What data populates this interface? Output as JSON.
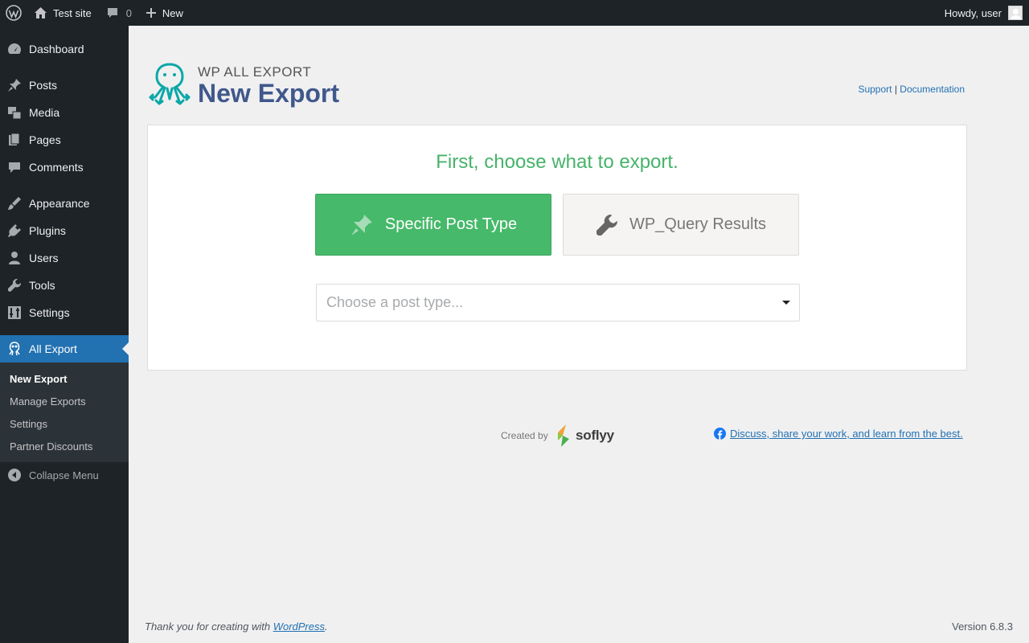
{
  "admin_bar": {
    "site_name": "Test site",
    "comments_count": "0",
    "new_label": "New",
    "howdy": "Howdy, user"
  },
  "sidebar": {
    "items": [
      {
        "label": "Dashboard",
        "icon": "dashboard-icon"
      },
      {
        "label": "Posts",
        "icon": "pin-icon"
      },
      {
        "label": "Media",
        "icon": "media-icon"
      },
      {
        "label": "Pages",
        "icon": "pages-icon"
      },
      {
        "label": "Comments",
        "icon": "comment-icon"
      },
      {
        "label": "Appearance",
        "icon": "brush-icon"
      },
      {
        "label": "Plugins",
        "icon": "plugin-icon"
      },
      {
        "label": "Users",
        "icon": "user-icon"
      },
      {
        "label": "Tools",
        "icon": "wrench-icon"
      },
      {
        "label": "Settings",
        "icon": "settings-icon"
      },
      {
        "label": "All Export",
        "icon": "octopus-icon"
      }
    ],
    "submenu": [
      {
        "label": "New Export"
      },
      {
        "label": "Manage Exports"
      },
      {
        "label": "Settings"
      },
      {
        "label": "Partner Discounts"
      }
    ],
    "collapse_label": "Collapse Menu"
  },
  "header": {
    "brand": "WP ALL EXPORT",
    "title": "New Export",
    "support_link": "Support",
    "separator": "|",
    "docs_link": "Documentation"
  },
  "panel": {
    "heading": "First, choose what to export.",
    "specific_label": "Specific Post Type",
    "wpquery_label": "WP_Query Results",
    "select_placeholder": "Choose a post type..."
  },
  "credits": {
    "created_by": "Created by",
    "company": "soflyy",
    "facebook_link": "Discuss, share your work, and learn from the best."
  },
  "footer": {
    "thanks_prefix": "Thank you for creating with ",
    "wordpress_link": "WordPress",
    "thanks_suffix": ".",
    "version": "Version 6.8.3"
  },
  "colors": {
    "accent": "#2271b1",
    "green": "#46b96a",
    "title_blue": "#40588b",
    "teal": "#0ba7a7"
  }
}
